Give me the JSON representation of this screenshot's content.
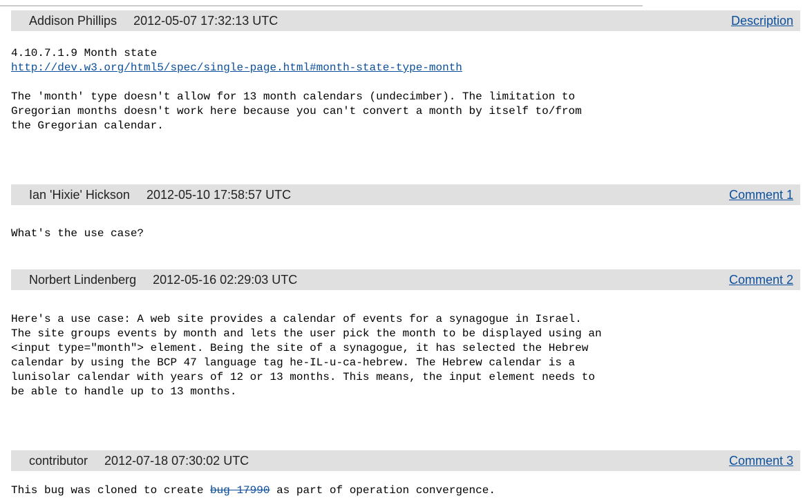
{
  "comments": [
    {
      "author": "Addison Phillips",
      "time": "2012-05-07 17:32:13 UTC",
      "link_label": "Description",
      "heading": "4.10.7.1.9 Month state",
      "url": "http://dev.w3.org/html5/spec/single-page.html#month-state-type-month",
      "text": "The 'month' type doesn't allow for 13 month calendars (undecimber). The limitation to\nGregorian months doesn't work here because you can't convert a month by itself to/from\nthe Gregorian calendar."
    },
    {
      "author": "Ian 'Hixie' Hickson",
      "time": "2012-05-10 17:58:57 UTC",
      "link_label": "Comment 1",
      "text": "What's the use case?"
    },
    {
      "author": "Norbert Lindenberg",
      "time": "2012-05-16 02:29:03 UTC",
      "link_label": "Comment 2",
      "text": "Here's a use case: A web site provides a calendar of events for a synagogue in Israel.\nThe site groups events by month and lets the user pick the month to be displayed using an\n<input type=\"month\"> element. Being the site of a synagogue, it has selected the Hebrew\ncalendar by using the BCP 47 language tag he-IL-u-ca-hebrew. The Hebrew calendar is a\nlunisolar calendar with years of 12 or 13 months. This means, the input element needs to\nbe able to handle up to 13 months."
    },
    {
      "author": "contributor",
      "time": "2012-07-18 07:30:02 UTC",
      "link_label": "Comment 3",
      "text_before": "This bug was cloned to create ",
      "bug_link": "bug 17990",
      "text_after": " as part of operation convergence."
    }
  ],
  "colors": {
    "header_bg": "#e0e0e0",
    "link": "#0b4f9c"
  }
}
